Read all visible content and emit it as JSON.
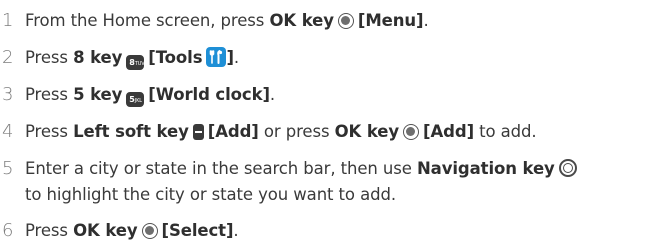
{
  "steps": [
    {
      "number": "1",
      "lead": "From the Home screen, press ",
      "key": "OK key",
      "action": "[Menu]",
      "tail": "."
    },
    {
      "number": "2",
      "lead": "Press ",
      "key": "8 key",
      "action": "[Tools",
      "action_close": "]",
      "tail": "."
    },
    {
      "number": "3",
      "lead": "Press ",
      "key": "5 key",
      "action": "[World clock]",
      "tail": "."
    },
    {
      "number": "4",
      "lead": "Press ",
      "key": "Left soft key",
      "action": "[Add]",
      "mid": " or press ",
      "key2": "OK key",
      "action2": "[Add]",
      "tail": " to add."
    },
    {
      "number": "5",
      "line1": "Enter a city or state in the search bar, then use ",
      "key": "Navigation key",
      "line2": "to highlight the city or state you want to add."
    },
    {
      "number": "6",
      "lead": "Press ",
      "key": "OK key",
      "action": "[Select]",
      "tail": "."
    }
  ],
  "icons": {
    "key8_digit": "8",
    "key8_letters": "TUV",
    "key5_digit": "5",
    "key5_letters": "JKL"
  },
  "colors": {
    "text": "#3a3a3a",
    "number": "#7d7d7d",
    "tools_icon_bg": "#1e8fd6"
  }
}
